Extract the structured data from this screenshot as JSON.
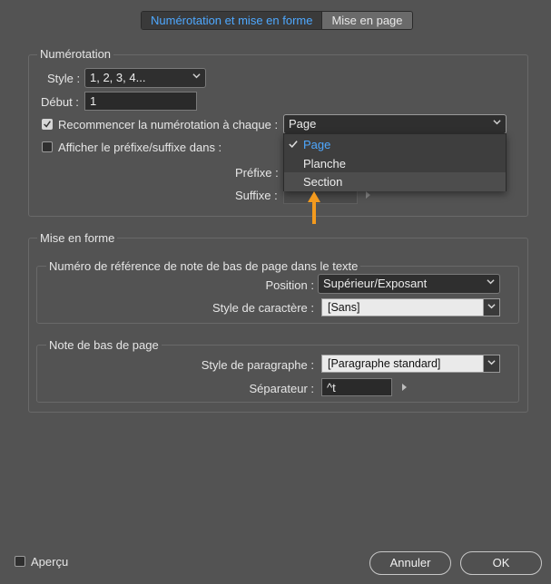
{
  "tabs": [
    {
      "label": "Numérotation et mise en forme",
      "active": true
    },
    {
      "label": "Mise en page",
      "active": false
    }
  ],
  "numbering": {
    "legend": "Numérotation",
    "style_label": "Style :",
    "style_value": "1, 2, 3, 4...",
    "start_label": "Début :",
    "start_value": "1",
    "restart_label": "Recommencer la numérotation à chaque :",
    "restart_checked": true,
    "restart_value": "Page",
    "prefix_toggle_label": "Afficher le préfixe/suffixe dans :",
    "prefix_toggle_checked": false,
    "prefix_label": "Préfixe :",
    "suffix_label": "Suffixe :"
  },
  "restart_menu": {
    "items": [
      {
        "label": "Page",
        "selected": true
      },
      {
        "label": "Planche",
        "selected": false
      },
      {
        "label": "Section",
        "selected": false
      }
    ]
  },
  "formatting": {
    "legend": "Mise en forme",
    "ref_group": {
      "legend": "Numéro de référence de note de bas de page dans le texte",
      "position_label": "Position :",
      "position_value": "Supérieur/Exposant",
      "char_style_label": "Style de caractère :",
      "char_style_value": "[Sans]"
    },
    "note_group": {
      "legend": "Note de bas de page",
      "para_style_label": "Style de paragraphe :",
      "para_style_value": "[Paragraphe standard]",
      "separator_label": "Séparateur :",
      "separator_value": "^t"
    }
  },
  "footer": {
    "preview_label": "Aperçu",
    "preview_checked": false,
    "cancel_label": "Annuler",
    "ok_label": "OK"
  },
  "colors": {
    "accent": "#4ea8ff",
    "pointer_arrow": "#f39a1e",
    "background": "#535353"
  },
  "icons": [
    "chevron-down-icon",
    "checkmark-icon",
    "arrow-up-icon",
    "triangle-right-icon"
  ]
}
